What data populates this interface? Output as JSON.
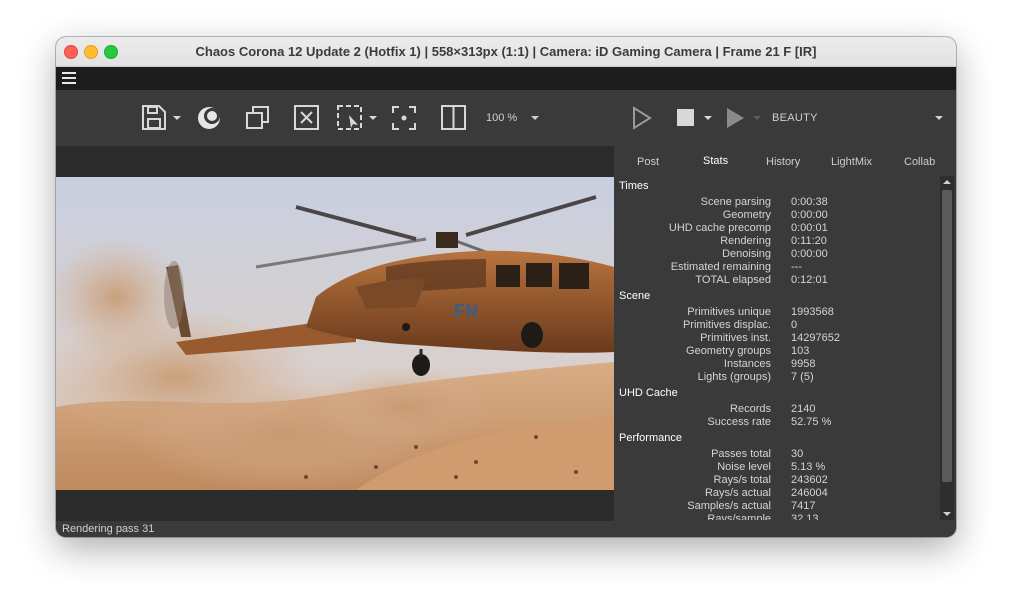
{
  "window": {
    "title": "Chaos Corona 12 Update 2 (Hotfix 1) | 558×313px (1:1) | Camera: iD Gaming Camera | Frame 21 F [IR]"
  },
  "toolbar": {
    "zoom": "100 %",
    "render_element": "BEAUTY"
  },
  "status_text": "Rendering pass 31",
  "tabs": [
    "Post",
    "Stats",
    "History",
    "LightMix",
    "Collab"
  ],
  "active_tab": "Stats",
  "stats": {
    "times": {
      "title": "Times",
      "rows": [
        {
          "label": "Scene parsing",
          "value": "0:00:38"
        },
        {
          "label": "Geometry",
          "value": "0:00:00"
        },
        {
          "label": "UHD cache precomp",
          "value": "0:00:01"
        },
        {
          "label": "Rendering",
          "value": "0:11:20"
        },
        {
          "label": "Denoising",
          "value": "0:00:00"
        },
        {
          "label": "Estimated remaining",
          "value": "---"
        },
        {
          "label": "TOTAL elapsed",
          "value": "0:12:01"
        }
      ]
    },
    "scene": {
      "title": "Scene",
      "rows": [
        {
          "label": "Primitives unique",
          "value": "1993568"
        },
        {
          "label": "Primitives displac.",
          "value": "0"
        },
        {
          "label": "Primitives inst.",
          "value": "14297652"
        },
        {
          "label": "Geometry groups",
          "value": "103"
        },
        {
          "label": "Instances",
          "value": "9958"
        },
        {
          "label": "Lights (groups)",
          "value": "7 (5)"
        }
      ]
    },
    "uhd": {
      "title": "UHD Cache",
      "rows": [
        {
          "label": "Records",
          "value": "2140"
        },
        {
          "label": "Success rate",
          "value": "52.75 %"
        }
      ]
    },
    "performance": {
      "title": "Performance",
      "rows": [
        {
          "label": "Passes total",
          "value": "30"
        },
        {
          "label": "Noise level",
          "value": "5.13 %"
        },
        {
          "label": "Rays/s total",
          "value": "243602"
        },
        {
          "label": "Rays/s actual",
          "value": "246004"
        },
        {
          "label": "Samples/s actual",
          "value": "7417"
        },
        {
          "label": "Rays/sample",
          "value": "32.13"
        }
      ]
    }
  },
  "colors": {
    "window_bg": "#3a3a3a",
    "menubar_bg": "#1c1c1c",
    "panel_text": "#d4d4d4"
  }
}
